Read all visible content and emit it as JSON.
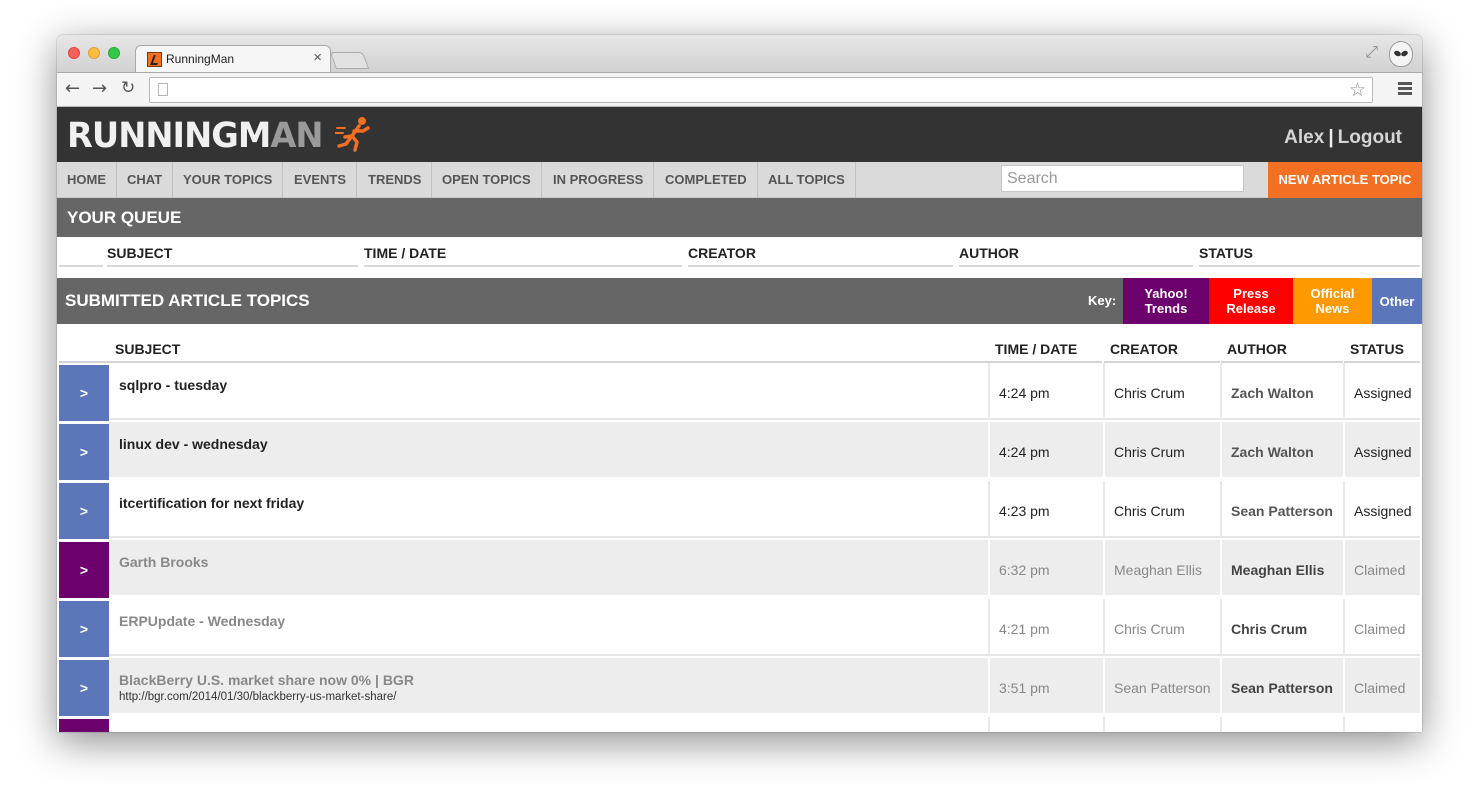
{
  "browser": {
    "tab_title": "RunningMan",
    "tab_close": "×",
    "url": "",
    "icons": [
      "back-arrow-icon",
      "forward-arrow-icon",
      "reload-icon",
      "page-icon",
      "star-icon",
      "menu-icon",
      "fullscreen-icon",
      "profile-icon"
    ]
  },
  "header": {
    "logo_running": "RUNNINGM",
    "logo_man": "AN",
    "user": "Alex",
    "separator": "|",
    "logout": "Logout"
  },
  "nav": {
    "items": [
      "HOME",
      "CHAT",
      "YOUR TOPICS",
      "EVENTS",
      "TRENDS",
      "OPEN TOPICS",
      "IN PROGRESS",
      "COMPLETED",
      "ALL TOPICS"
    ],
    "search_placeholder": "Search",
    "new_topic": "NEW ARTICLE TOPIC"
  },
  "queue": {
    "title": "YOUR QUEUE",
    "columns": [
      "SUBJECT",
      "TIME / DATE",
      "CREATOR",
      "AUTHOR",
      "STATUS"
    ]
  },
  "submitted": {
    "title": "SUBMITTED ARTICLE TOPICS",
    "key_label": "Key:",
    "keys": [
      {
        "label": "Yahoo! Trends",
        "color": "#6c006c"
      },
      {
        "label": "Press Release",
        "color": "#ff0000"
      },
      {
        "label": "Official News",
        "color": "#ff9900"
      },
      {
        "label": "Other",
        "color": "#5b77b9"
      }
    ],
    "columns": [
      "SUBJECT",
      "TIME / DATE",
      "CREATOR",
      "AUTHOR",
      "STATUS"
    ],
    "rows": [
      {
        "expand": ">",
        "color": "#5b77b9",
        "subject": "sqlpro - tuesday",
        "url": "",
        "time": "4:24 pm",
        "creator": "Chris Crum",
        "author": "Zach Walton",
        "status": "Assigned",
        "state": "active"
      },
      {
        "expand": ">",
        "color": "#5b77b9",
        "subject": "linux dev - wednesday",
        "url": "",
        "time": "4:24 pm",
        "creator": "Chris Crum",
        "author": "Zach Walton",
        "status": "Assigned",
        "state": "active"
      },
      {
        "expand": ">",
        "color": "#5b77b9",
        "subject": "itcertification for next friday",
        "url": "",
        "time": "4:23 pm",
        "creator": "Chris Crum",
        "author": "Sean Patterson",
        "status": "Assigned",
        "state": "active"
      },
      {
        "expand": ">",
        "color": "#6c006c",
        "subject": "Garth Brooks",
        "url": "",
        "time": "6:32 pm",
        "creator": "Meaghan Ellis",
        "author": "Meaghan Ellis",
        "status": "Claimed",
        "state": "claimed"
      },
      {
        "expand": ">",
        "color": "#5b77b9",
        "subject": "ERPUpdate - Wednesday",
        "url": "",
        "time": "4:21 pm",
        "creator": "Chris Crum",
        "author": "Chris Crum",
        "status": "Claimed",
        "state": "claimed"
      },
      {
        "expand": ">",
        "color": "#5b77b9",
        "subject": "BlackBerry U.S. market share now 0% | BGR",
        "url": "http://bgr.com/2014/01/30/blackberry-us-market-share/",
        "time": "3:51 pm",
        "creator": "Sean Patterson",
        "author": "Sean Patterson",
        "status": "Claimed",
        "state": "claimed"
      },
      {
        "expand": "",
        "color": "#6c006c",
        "subject": "",
        "url": "",
        "time": "",
        "creator": "",
        "author": "",
        "status": "",
        "state": "claimed"
      }
    ]
  }
}
